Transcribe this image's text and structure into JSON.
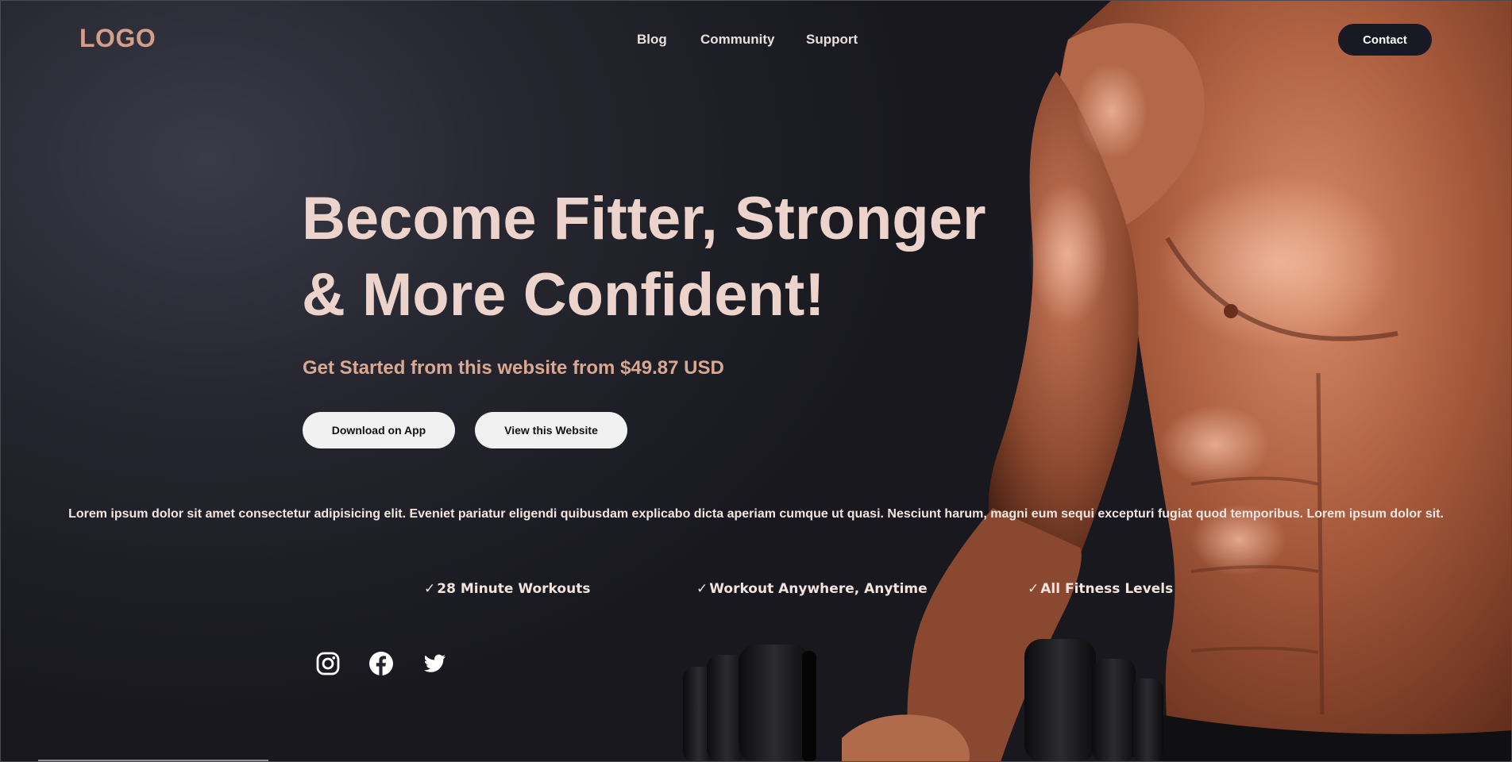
{
  "header": {
    "logo": "LOGO",
    "nav": [
      {
        "label": "Blog"
      },
      {
        "label": "Community"
      },
      {
        "label": "Support"
      }
    ],
    "contact_label": "Contact"
  },
  "hero": {
    "headline_line1": "Become Fitter, Stronger",
    "headline_line2": "& More Confident!",
    "subline": "Get Started from this website from $49.87 USD",
    "buttons": {
      "download_app": "Download on App",
      "view_website": "View this Website"
    },
    "description": "Lorem ipsum dolor sit amet consectetur adipisicing elit. Eveniet pariatur eligendi quibusdam explicabo dicta aperiam cumque ut quasi. Nesciunt harum, magni eum sequi excepturi fugiat quod temporibus. Lorem ipsum dolor sit."
  },
  "features": [
    {
      "check": "✓",
      "label": "28 Minute Workouts"
    },
    {
      "check": "✓",
      "label": "Workout Anywhere, Anytime"
    },
    {
      "check": "✓",
      "label": "All Fitness Levels"
    }
  ],
  "social": [
    {
      "icon": "instagram-icon"
    },
    {
      "icon": "facebook-icon"
    },
    {
      "icon": "twitter-icon"
    }
  ],
  "colors": {
    "background": "#1b1b22",
    "logo": "#d49e8a",
    "headline": "#ecd4cc",
    "subline": "#d9a892",
    "button_bg": "#f2f1f1",
    "contact_bg": "#181922"
  }
}
